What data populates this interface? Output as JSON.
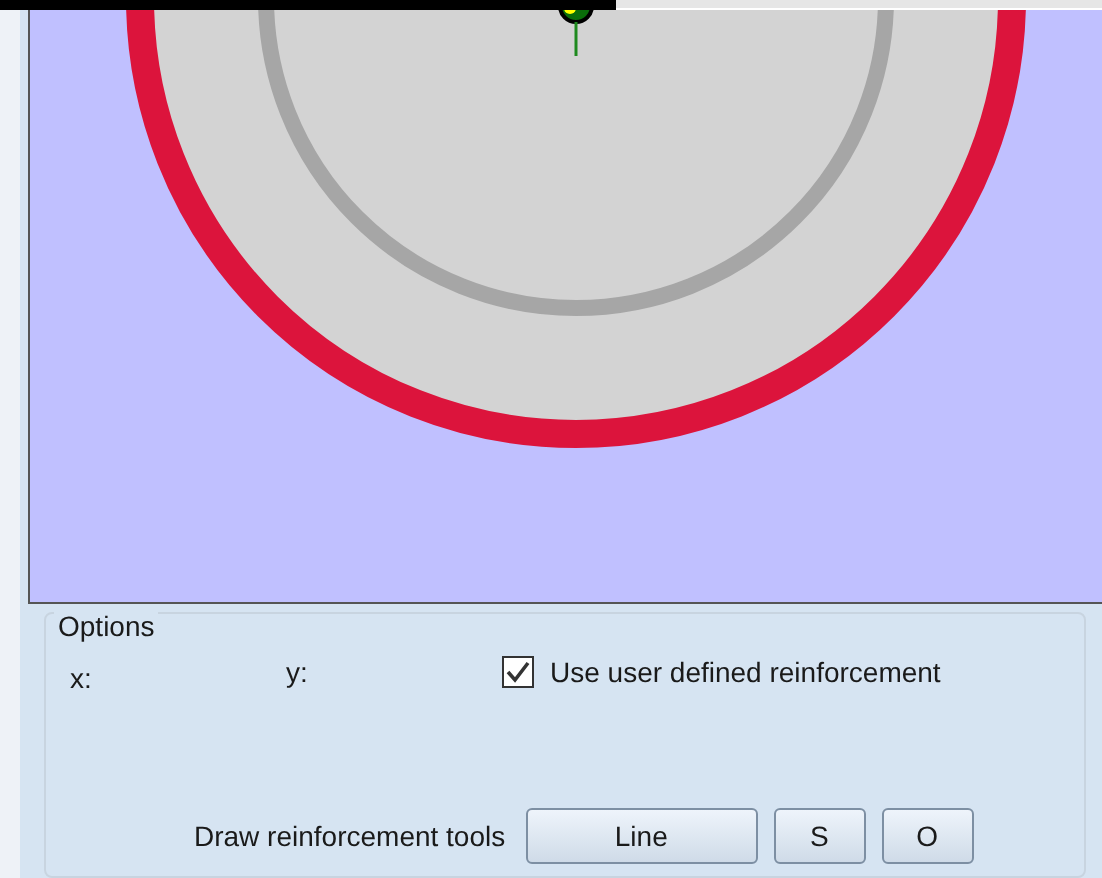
{
  "options": {
    "title": "Options",
    "x_label": "x:",
    "y_label": "y:",
    "user_reinforcement": {
      "label": "Use user defined reinforcement",
      "checked": true
    }
  },
  "tools": {
    "label": "Draw reinforcement tools",
    "buttons": [
      "Line",
      "S",
      "O"
    ]
  }
}
